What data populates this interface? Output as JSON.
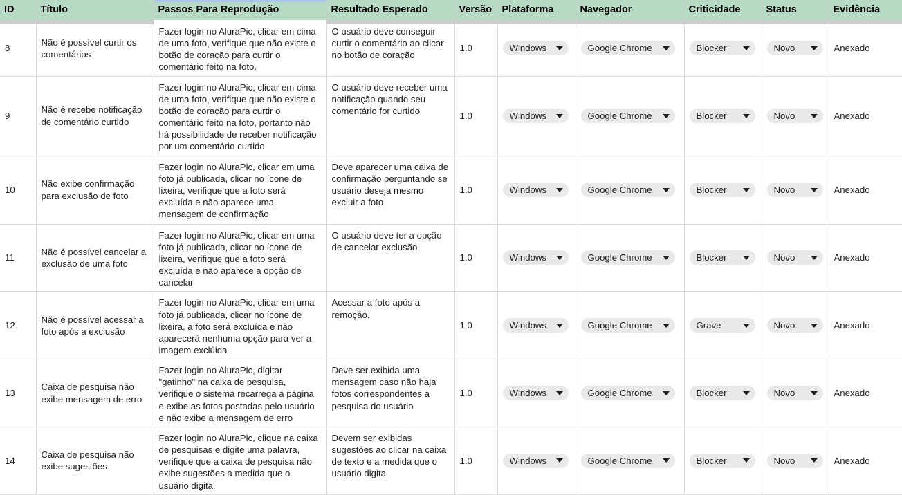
{
  "spreadsheet": {
    "selected_column": "Passos Para Reprodução",
    "colors": {
      "header_background": "#b7dac4",
      "chip_background": "#e9e9e9",
      "grid_line": "#d9d9d9",
      "selection_blue": "#a9c7e8",
      "text": "#202124"
    }
  },
  "table": {
    "columns": [
      {
        "key": "id",
        "label": "ID"
      },
      {
        "key": "titulo",
        "label": "Título"
      },
      {
        "key": "passos",
        "label": "Passos Para Reprodução"
      },
      {
        "key": "resultado",
        "label": "Resultado Esperado"
      },
      {
        "key": "versao",
        "label": "Versão"
      },
      {
        "key": "plataforma",
        "label": "Plataforma"
      },
      {
        "key": "navegador",
        "label": "Navegador"
      },
      {
        "key": "criticidade",
        "label": "Criticidade"
      },
      {
        "key": "status",
        "label": "Status"
      },
      {
        "key": "evidencia",
        "label": "Evidência"
      }
    ],
    "rows": [
      {
        "id": "8",
        "titulo": "Não é possível curtir os comentários",
        "passos": "Fazer login no AluraPic, clicar em cima de uma foto, verifique que não existe o botão de coração para curtir o comentário feito na foto.",
        "resultado": "O usuário deve conseguir curtir o comentário ao clicar no botão de coração",
        "versao": "1.0",
        "plataforma": "Windows",
        "navegador": "Google Chrome",
        "criticidade": "Blocker",
        "status": "Novo",
        "evidencia": "Anexado"
      },
      {
        "id": "9",
        "titulo": "Não é recebe notificação de comentário curtido",
        "passos": "Fazer login no AluraPic, clicar em cima de uma foto, verifique que não existe o botão de coração para curtir o comentário feito na foto, portanto não há possibilidade de receber notificação por um comentário curtido",
        "resultado": "O usuário deve receber uma notificação quando seu comentário for curtido",
        "versao": "1.0",
        "plataforma": "Windows",
        "navegador": "Google Chrome",
        "criticidade": "Blocker",
        "status": "Novo",
        "evidencia": "Anexado"
      },
      {
        "id": "10",
        "titulo": "Não exibe confirmação para exclusão de foto",
        "passos": "Fazer login no AluraPic, clicar em uma foto já publicada, clicar no ícone de lixeira, verifique que a foto será excluída e não aparece uma mensagem de confirmação",
        "resultado": "Deve aparecer uma caixa de confirmação perguntando se usuário deseja mesmo excluir a foto",
        "versao": "1.0",
        "plataforma": "Windows",
        "navegador": "Google Chrome",
        "criticidade": "Blocker",
        "status": "Novo",
        "evidencia": "Anexado"
      },
      {
        "id": "11",
        "titulo": "Não é possível cancelar a exclusão de uma foto",
        "passos": "Fazer login no AluraPic, clicar em uma foto já publicada, clicar no ícone de lixeira, verifique que a foto será excluída e não aparece a opção de cancelar",
        "resultado": "O usuário deve ter a opção de cancelar exclusão",
        "versao": "1.0",
        "plataforma": "Windows",
        "navegador": "Google Chrome",
        "criticidade": "Blocker",
        "status": "Novo",
        "evidencia": "Anexado"
      },
      {
        "id": "12",
        "titulo": "Não é possível acessar a foto após a exclusão",
        "passos": "Fazer login no AluraPic, clicar em uma foto já publicada, clicar no ícone de lixeira, a foto será excluída e não aparecerá nenhuma opção para ver a imagem exclúida",
        "resultado": "Acessar a foto após a remoção.",
        "versao": "1.0",
        "plataforma": "Windows",
        "navegador": "Google Chrome",
        "criticidade": "Grave",
        "status": "Novo",
        "evidencia": "Anexado"
      },
      {
        "id": "13",
        "titulo": "Caixa de pesquisa não exibe mensagem de erro",
        "passos": "Fazer login no AluraPic, digitar \"gatinho\" na caixa de pesquisa, verifique o sistema recarrega a página e exibe as fotos postadas pelo usuário e não exibe a mensagem de erro",
        "resultado": "Deve ser exibida uma mensagem caso não haja fotos correspondentes a pesquisa do usuário",
        "versao": "1.0",
        "plataforma": "Windows",
        "navegador": "Google Chrome",
        "criticidade": "Blocker",
        "status": "Novo",
        "evidencia": "Anexado"
      },
      {
        "id": "14",
        "titulo": "Caixa de pesquisa não exibe sugestões",
        "passos": "Fazer login no AluraPic, clique na caixa de pesquisas e digite uma palavra, verifique que a caixa de pesquisa não exibe sugestões a medida que o usuário digita",
        "resultado": "Devem ser exibidas sugestões ao clicar na caixa de texto e a medida que o usuário digita",
        "versao": "1.0",
        "plataforma": "Windows",
        "navegador": "Google Chrome",
        "criticidade": "Blocker",
        "status": "Novo",
        "evidencia": "Anexado"
      }
    ]
  }
}
